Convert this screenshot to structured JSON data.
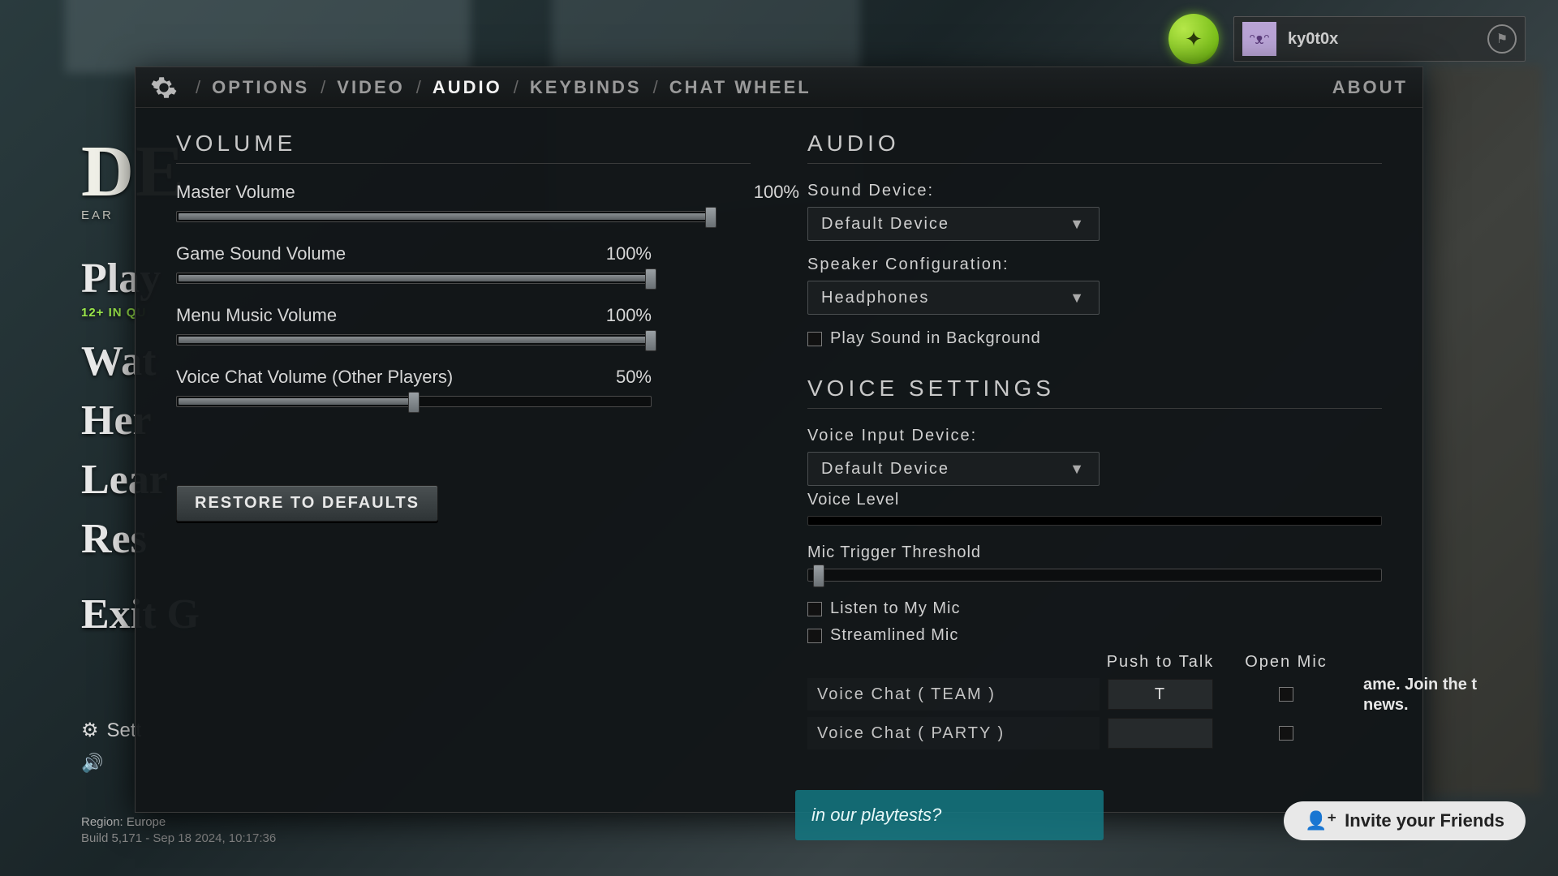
{
  "user": {
    "name": "ky0t0x"
  },
  "tabs": {
    "options": "OPTIONS",
    "video": "VIDEO",
    "audio": "AUDIO",
    "keybinds": "KEYBINDS",
    "chat_wheel": "CHAT WHEEL",
    "about": "ABOUT"
  },
  "sidebar": {
    "logo": "DE",
    "logo_sub": "EAR",
    "items": [
      "Play",
      "Wat",
      "Her",
      "Lear",
      "Res"
    ],
    "queue_sub": "12+ IN QU",
    "settings": "Sett",
    "exit": "Exit G"
  },
  "region": {
    "label": "Region:",
    "value": "Europe"
  },
  "build": "Build 5,171 - Sep 18 2024, 10:17:36",
  "volume": {
    "title": "VOLUME",
    "master": {
      "label": "Master Volume",
      "value": "100%",
      "pct": 100
    },
    "game": {
      "label": "Game Sound Volume",
      "value": "100%",
      "pct": 100
    },
    "menu": {
      "label": "Menu Music Volume",
      "value": "100%",
      "pct": 100
    },
    "voice": {
      "label": "Voice Chat Volume (Other Players)",
      "value": "50%",
      "pct": 50
    },
    "restore": "RESTORE TO DEFAULTS"
  },
  "audio": {
    "title": "AUDIO",
    "sound_device_label": "Sound Device:",
    "sound_device_value": "Default Device",
    "speaker_label": "Speaker Configuration:",
    "speaker_value": "Headphones",
    "play_bg": "Play Sound in Background"
  },
  "voice": {
    "title": "VOICE SETTINGS",
    "input_label": "Voice Input Device:",
    "input_value": "Default Device",
    "level_label": "Voice Level",
    "threshold_label": "Mic Trigger Threshold",
    "listen": "Listen to My Mic",
    "streamlined": "Streamlined Mic",
    "col_ptt": "Push to Talk",
    "col_open": "Open Mic",
    "team": {
      "label": "Voice Chat ( TEAM )",
      "key": "T"
    },
    "party": {
      "label": "Voice Chat ( PARTY )",
      "key": ""
    }
  },
  "footer": {
    "playtest": "in our playtests?",
    "invite": "Invite your Friends",
    "join": "ame. Join the t news."
  }
}
